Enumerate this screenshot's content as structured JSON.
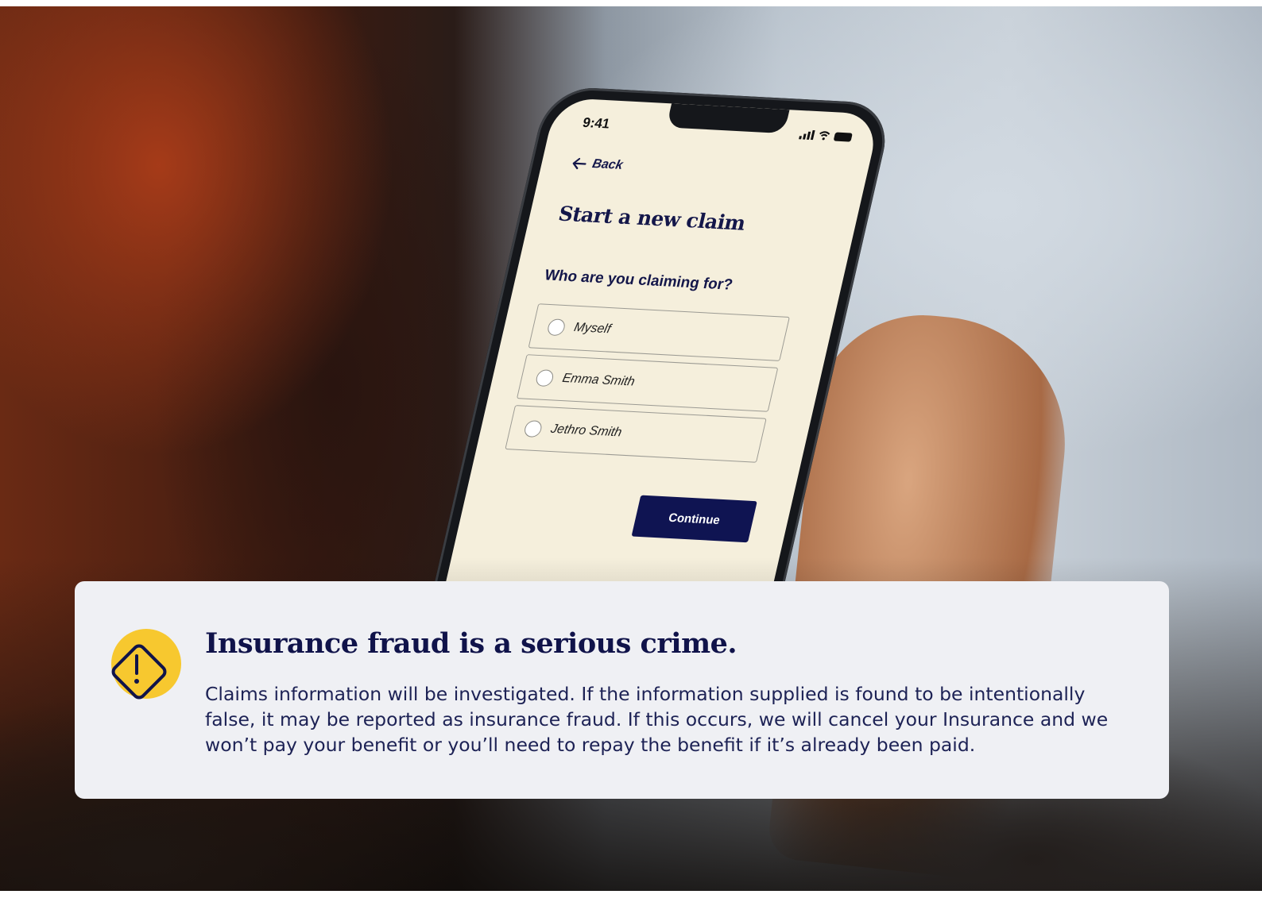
{
  "phone": {
    "time": "9:41",
    "back_label": "Back",
    "title": "Start a new claim",
    "question": "Who are you claiming for?",
    "options": [
      {
        "label": "Myself"
      },
      {
        "label": "Emma Smith"
      },
      {
        "label": "Jethro Smith"
      }
    ],
    "continue_label": "Continue",
    "colors": {
      "screen_bg": "#f5efdc",
      "primary": "#0f1452"
    }
  },
  "warning": {
    "icon": "warning-diamond-icon",
    "title": "Insurance fraud is a serious crime.",
    "body": "Claims information will be investigated. If the information supplied is found to be intentionally false, it may be reported as insurance fraud. If this occurs, we will cancel your Insurance and we won’t pay your benefit or you’ll need to repay the benefit if it’s already been paid.",
    "colors": {
      "card_bg": "#eff0f4",
      "accent": "#f7c82f",
      "text": "#10134a"
    }
  }
}
